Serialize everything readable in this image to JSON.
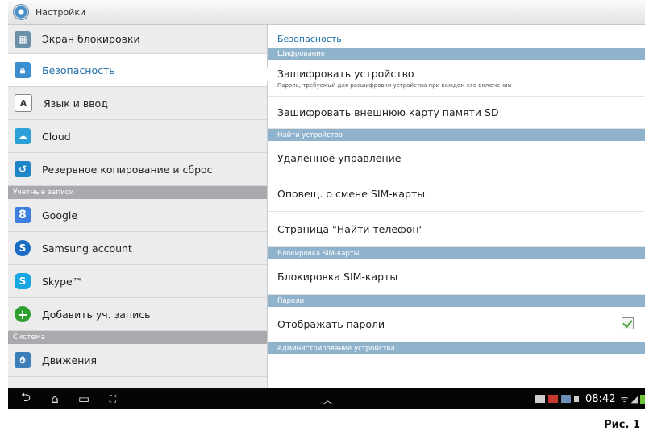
{
  "app": {
    "title": "Настройки",
    "icon": "settings-gear-icon"
  },
  "left_list": {
    "items_top": [
      {
        "label": "Экран блокировки",
        "icon": "lock-screen-icon",
        "color": "#6a8fa8"
      },
      {
        "label": "Безопасность",
        "icon": "padlock-icon",
        "color": "#3b8fd1",
        "selected": true
      },
      {
        "label": "Язык и ввод",
        "icon": "language-a-icon",
        "color": "#ffffff"
      },
      {
        "label": "Cloud",
        "icon": "cloud-icon",
        "color": "#2b9fd6"
      },
      {
        "label": "Резервное копирование и сброс",
        "icon": "backup-icon",
        "color": "#1e86c8"
      }
    ],
    "section_accounts": "Учетные записи",
    "items_accounts": [
      {
        "label": "Google",
        "icon": "google-icon",
        "color": "#3d7fe0"
      },
      {
        "label": "Samsung account",
        "icon": "samsung-account-icon",
        "color": "#1a6bc4"
      },
      {
        "label": "Skype™",
        "icon": "skype-icon",
        "color": "#18a6e4"
      },
      {
        "label": "Добавить уч. запись",
        "icon": "add-account-icon",
        "color": "#2e9e2e"
      }
    ],
    "section_system": "Система",
    "items_system": [
      {
        "label": "Движения",
        "icon": "motion-icon",
        "color": "#3a7fb8"
      }
    ]
  },
  "right_pane": {
    "title": "Безопасность",
    "sections": {
      "encryption": "Шифрование",
      "find_device": "Найти устройство",
      "sim_lock": "Блокировка SIM-карты",
      "passwords": "Пароли",
      "admin": "Администрирование устройства"
    },
    "items": {
      "encrypt_device": {
        "title": "Зашифровать устройство",
        "subtitle": "Пароль, требуемый для расшифровки устройства при каждом его включении"
      },
      "encrypt_sd": {
        "title": "Зашифровать внешнюю карту памяти SD"
      },
      "remote_control": {
        "title": "Удаленное управление"
      },
      "sim_change_alert": {
        "title": "Оповещ. о смене SIM-карты"
      },
      "find_phone_page": {
        "title": "Страница \"Найти телефон\""
      },
      "sim_lock": {
        "title": "Блокировка SIM-карты"
      },
      "show_passwords": {
        "title": "Отображать пароли",
        "checked": true
      }
    }
  },
  "navbar": {
    "clock": "08:42",
    "icons": [
      "back-icon",
      "home-icon",
      "recent-apps-icon",
      "screenshot-icon",
      "chevron-up-icon"
    ]
  },
  "caption": "Рис. 1"
}
